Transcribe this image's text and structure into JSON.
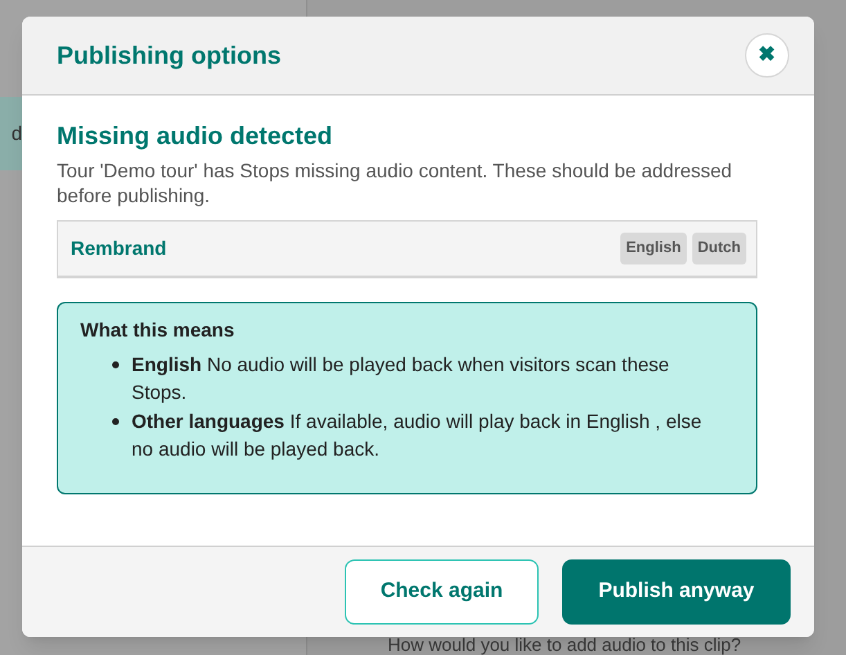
{
  "background": {
    "side_tab": "d",
    "prompt": "How would you like to add audio to this clip?"
  },
  "dialog": {
    "title": "Publishing options",
    "close": "✖",
    "heading": "Missing audio detected",
    "message": "Tour 'Demo tour' has Stops missing audio content. These should be addressed before publishing.",
    "stops": [
      {
        "name": "Rembrand",
        "languages": [
          "English",
          "Dutch"
        ]
      }
    ],
    "info": {
      "title": "What this means",
      "items": [
        {
          "text": "**English** No audio will be played back when visitors scan these Stops."
        },
        {
          "text": "**Other languages** If available, audio will play back in English , else no audio will be played back."
        }
      ]
    },
    "buttons": [
      {
        "label": "Check again",
        "kind": "secondary"
      },
      {
        "label": "Publish anyway",
        "kind": "primary"
      }
    ]
  }
}
